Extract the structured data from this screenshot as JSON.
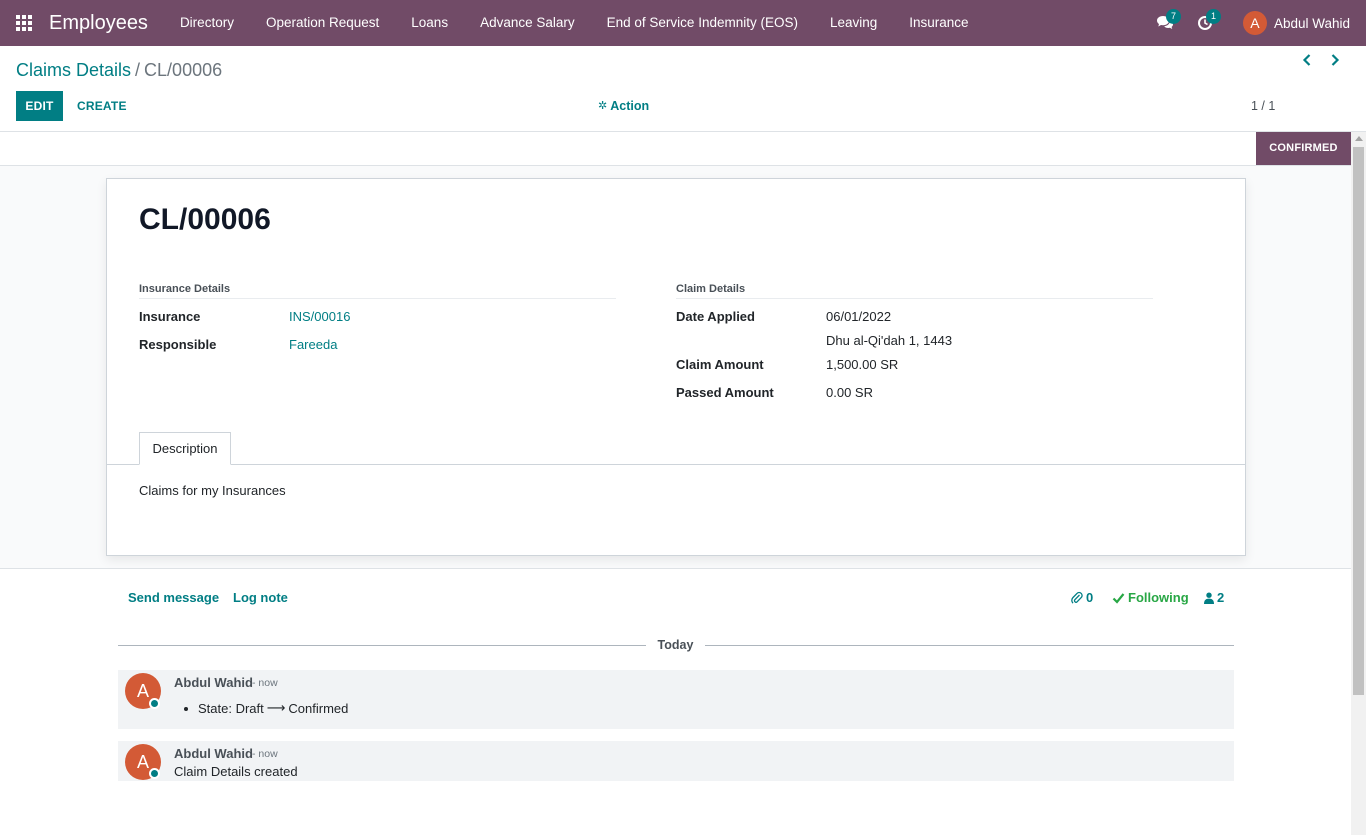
{
  "navbar": {
    "app_title": "Employees",
    "menu": [
      "Directory",
      "Operation Request",
      "Loans",
      "Advance Salary",
      "End of Service Indemnity (EOS)",
      "Leaving",
      "Insurance"
    ],
    "messages_count": "7",
    "activities_count": "1",
    "user_initial": "A",
    "user_name": "Abdul Wahid"
  },
  "control_panel": {
    "breadcrumb_parent": "Claims Details",
    "breadcrumb_sep": "/",
    "breadcrumb_current": "CL/00006",
    "edit_label": "EDIT",
    "create_label": "CREATE",
    "action_label": "Action",
    "pager_value": "1 / 1"
  },
  "statusbar": {
    "stage": "CONFIRMED"
  },
  "form": {
    "record_name": "CL/00006",
    "insurance_group": {
      "title": "Insurance Details",
      "insurance_label": "Insurance",
      "insurance_value": "INS/00016",
      "responsible_label": "Responsible",
      "responsible_value": "Fareeda"
    },
    "claim_group": {
      "title": "Claim Details",
      "date_label": "Date Applied",
      "date_value": "06/01/2022",
      "hijri_date": "Dhu al-Qi'dah 1, 1443",
      "claim_amount_label": "Claim Amount",
      "claim_amount_value": "1,500.00 SR",
      "passed_amount_label": "Passed Amount",
      "passed_amount_value": "0.00 SR"
    },
    "tab_label": "Description",
    "description": "Claims for my Insurances"
  },
  "chatter": {
    "send_message": "Send message",
    "log_note": "Log note",
    "attachments_count": "0",
    "following_label": "Following",
    "followers_count": "2",
    "today_label": "Today",
    "messages": [
      {
        "initial": "A",
        "author": "Abdul Wahid",
        "time": "- now",
        "field": "State:",
        "old_value": "Draft",
        "arrow": "⟶",
        "new_value": "Confirmed"
      },
      {
        "initial": "A",
        "author": "Abdul Wahid",
        "time": "- now",
        "body": "Claim Details created"
      }
    ]
  },
  "colors": {
    "brand": "#714B67",
    "link": "#017E84",
    "following": "#28a745",
    "avatar": "#D35A36"
  }
}
